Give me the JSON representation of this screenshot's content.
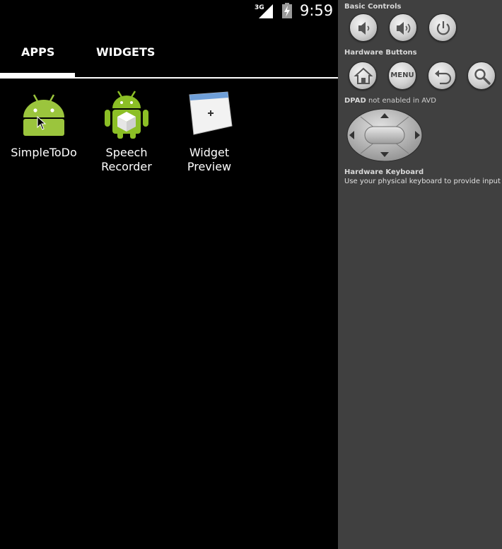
{
  "status_bar": {
    "network": "3G",
    "time": "9:59"
  },
  "tabs": [
    {
      "label": "APPS",
      "selected": true
    },
    {
      "label": "WIDGETS",
      "selected": false
    }
  ],
  "apps": [
    {
      "label": "SimpleToDo",
      "icon": "android-robot-icon"
    },
    {
      "label": "Speech\nRecorder",
      "icon": "speech-recorder-icon"
    },
    {
      "label": "Widget\nPreview",
      "icon": "widget-preview-icon"
    }
  ],
  "panel": {
    "basic_controls": {
      "title": "Basic Controls",
      "buttons": [
        "volume-down-icon",
        "volume-up-icon",
        "power-icon"
      ]
    },
    "hardware_buttons": {
      "title": "Hardware Buttons",
      "buttons": [
        "home-icon",
        "MENU",
        "back-icon",
        "search-icon"
      ]
    },
    "dpad": {
      "title_strong": "DPAD",
      "title_rest": " not enabled in AVD"
    },
    "keyboard": {
      "title": "Hardware Keyboard",
      "desc": "Use your physical keyboard to provide input"
    }
  },
  "colors": {
    "panel_bg": "#404040",
    "screen_bg": "#000000",
    "android_green": "#9BC53D"
  }
}
